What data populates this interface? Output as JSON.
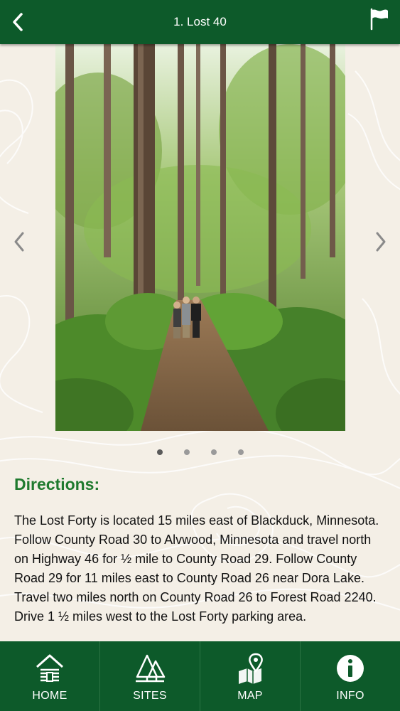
{
  "header": {
    "title": "1. Lost 40",
    "back_icon": "chevron-left-icon",
    "flag_icon": "flag-icon"
  },
  "carousel": {
    "image_description_alt": "",
    "current_index": 1,
    "total": 4
  },
  "content": {
    "heading": "Directions:",
    "body": "The Lost Forty is located 15 miles east of Blackduck, Minnesota. Follow County Road 30 to Alvwood, Minnesota and travel north on Highway 46 for ½ mile to County Road 29. Follow County Road 29 for 11 miles east to County Road 26 near Dora Lake. Travel two miles north on County Road 26 to Forest Road 2240. Drive 1 ½ miles west to the Lost Forty parking area."
  },
  "tabs": [
    {
      "label": "HOME",
      "icon": "cabin-icon"
    },
    {
      "label": "SITES",
      "icon": "pine-trees-icon"
    },
    {
      "label": "MAP",
      "icon": "map-pin-icon"
    },
    {
      "label": "INFO",
      "icon": "info-icon"
    }
  ],
  "colors": {
    "brand_green": "#0d5a2a",
    "heading_green": "#1f7a2e",
    "background": "#f4efe6"
  }
}
